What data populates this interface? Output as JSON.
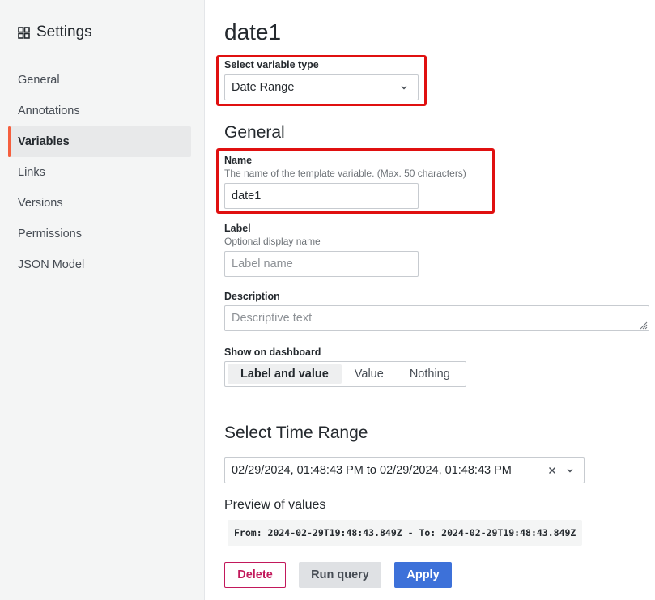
{
  "sidebar": {
    "title": "Settings",
    "items": [
      {
        "label": "General"
      },
      {
        "label": "Annotations"
      },
      {
        "label": "Variables",
        "active": true
      },
      {
        "label": "Links"
      },
      {
        "label": "Versions"
      },
      {
        "label": "Permissions"
      },
      {
        "label": "JSON Model"
      }
    ]
  },
  "main": {
    "title": "date1",
    "variable_type": {
      "label": "Select variable type",
      "value": "Date Range"
    },
    "general_heading": "General",
    "name": {
      "label": "Name",
      "description": "The name of the template variable. (Max. 50 characters)",
      "value": "date1"
    },
    "label_field": {
      "label": "Label",
      "description": "Optional display name",
      "placeholder": "Label name"
    },
    "description_field": {
      "label": "Description",
      "placeholder": "Descriptive text"
    },
    "show_on_dashboard": {
      "label": "Show on dashboard",
      "options": [
        "Label and value",
        "Value",
        "Nothing"
      ],
      "selected": "Label and value"
    },
    "time_range": {
      "heading": "Select Time Range",
      "value": "02/29/2024, 01:48:43 PM to 02/29/2024, 01:48:43 PM"
    },
    "preview": {
      "heading": "Preview of values",
      "value": "From: 2024-02-29T19:48:43.849Z - To: 2024-02-29T19:48:43.849Z"
    },
    "buttons": {
      "delete": "Delete",
      "run_query": "Run query",
      "apply": "Apply"
    }
  },
  "colors": {
    "accent": "#f55f3e",
    "primary": "#3d71d9",
    "danger": "#c2185b",
    "highlight": "#e01010"
  }
}
